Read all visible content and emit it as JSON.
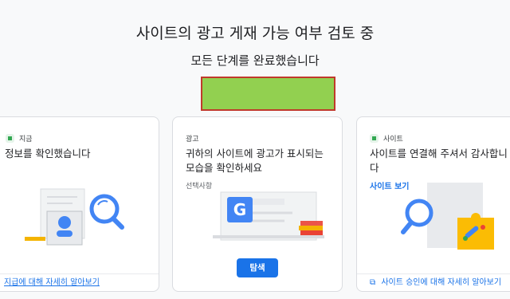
{
  "header": {
    "title": "사이트의 광고 게재 가능 여부 검토 중",
    "subtitle": "모든 단계를 완료했습니다"
  },
  "cards": [
    {
      "tag": "지금",
      "text": "정보를 확인했습니다",
      "footer_link": "지급에 대해 자세히 알아보기"
    },
    {
      "tag": "광고",
      "text_line1": "귀하의 사이트에 광고가 표시되는",
      "text_line2": "모습을 확인하세요",
      "optional": "선택사항",
      "button": "탐색",
      "logo_letter": "G"
    },
    {
      "tag": "사이트",
      "text_line1": "사이트를 연결해 주셔서 감사합니",
      "text_line2": "다",
      "link": "사이트 보기",
      "footer_link": "사이트 승인에 대해 자세히 알아보기"
    }
  ],
  "colors": {
    "accent": "#1a73e8",
    "highlight_box": "#92d050",
    "highlight_border": "#c0392b",
    "tag_green": "#34a853"
  }
}
